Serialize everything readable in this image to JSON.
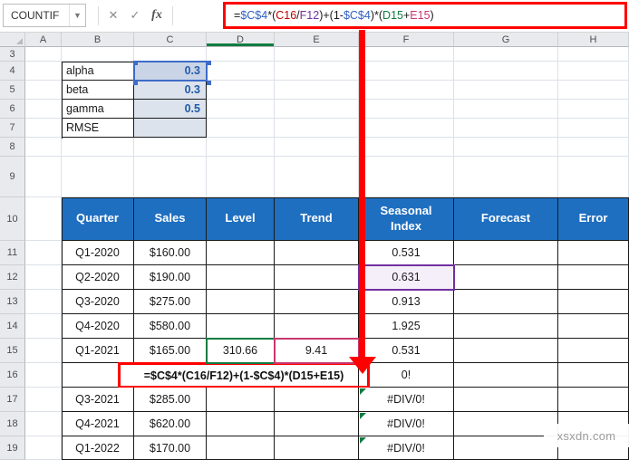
{
  "formula_bar": {
    "name_box": "COUNTIF",
    "fx_label": "fx",
    "formula_full": "=$C$4*(C16/F12)+(1-$C$4)*(D15+E15)",
    "formula_parts": [
      {
        "t": "=",
        "c": "#1a1a1a"
      },
      {
        "t": "$C$4",
        "c": "#2E5FC1"
      },
      {
        "t": "*(",
        "c": "#1a1a1a"
      },
      {
        "t": "C16",
        "c": "#C00000"
      },
      {
        "t": "/",
        "c": "#1a1a1a"
      },
      {
        "t": "F12",
        "c": "#7030A0"
      },
      {
        "t": ")+(1-",
        "c": "#1a1a1a"
      },
      {
        "t": "$C$4",
        "c": "#2E5FC1"
      },
      {
        "t": ")*(",
        "c": "#1a1a1a"
      },
      {
        "t": "D15",
        "c": "#107C41"
      },
      {
        "t": "+",
        "c": "#1a1a1a"
      },
      {
        "t": "E15",
        "c": "#C9366F"
      },
      {
        "t": ")",
        "c": "#1a1a1a"
      }
    ]
  },
  "icons": {
    "dropdown": "▼",
    "cancel": "✕",
    "enter": "✓"
  },
  "grid": {
    "column_letters": [
      "A",
      "B",
      "C",
      "D",
      "E",
      "F",
      "G",
      "H"
    ],
    "row_numbers": [
      "3",
      "4",
      "5",
      "6",
      "7",
      "8",
      "9",
      "10",
      "11",
      "12",
      "13",
      "14",
      "15",
      "16",
      "17",
      "18",
      "19"
    ],
    "selected_column": "D"
  },
  "params_table": {
    "selected_cell": "C4",
    "rows": [
      {
        "label": "alpha",
        "value": "0.3"
      },
      {
        "label": "beta",
        "value": "0.3"
      },
      {
        "label": "gamma",
        "value": "0.5"
      },
      {
        "label": "RMSE",
        "value": ""
      }
    ]
  },
  "main_table": {
    "headers": [
      "Quarter",
      "Sales",
      "Level",
      "Trend",
      "Seasonal Index",
      "Forecast",
      "Error"
    ],
    "rows": [
      {
        "quarter": "Q1-2020",
        "sales": "$160.00",
        "level": "",
        "trend": "",
        "seasonal": "0.531",
        "forecast": "",
        "error": ""
      },
      {
        "quarter": "Q2-2020",
        "sales": "$190.00",
        "level": "",
        "trend": "",
        "seasonal": "0.631",
        "forecast": "",
        "error": ""
      },
      {
        "quarter": "Q3-2020",
        "sales": "$275.00",
        "level": "",
        "trend": "",
        "seasonal": "0.913",
        "forecast": "",
        "error": ""
      },
      {
        "quarter": "Q4-2020",
        "sales": "$580.00",
        "level": "",
        "trend": "",
        "seasonal": "1.925",
        "forecast": "",
        "error": ""
      },
      {
        "quarter": "Q1-2021",
        "sales": "$165.00",
        "level": "310.66",
        "trend": "9.41",
        "seasonal": "0.531",
        "forecast": "",
        "error": ""
      },
      {
        "formula_row": true,
        "formula": "=$C$4*(C16/F12)+(1-$C$4)*(D15+E15)",
        "seasonal": "0!",
        "forecast": "",
        "error": ""
      },
      {
        "quarter": "Q3-2021",
        "sales": "$285.00",
        "level": "",
        "trend": "",
        "seasonal": "#DIV/0!",
        "forecast": "",
        "error": "",
        "error_indicator": true
      },
      {
        "quarter": "Q4-2021",
        "sales": "$620.00",
        "level": "",
        "trend": "",
        "seasonal": "#DIV/0!",
        "forecast": "",
        "error": "",
        "error_indicator": true
      },
      {
        "quarter": "Q1-2022",
        "sales": "$170.00",
        "level": "",
        "trend": "",
        "seasonal": "#DIV/0!",
        "forecast": "",
        "error": "",
        "error_indicator": true
      }
    ]
  },
  "colors": {
    "header_blue": "#1F6FC0",
    "param_value_blue": "#1F5BA8",
    "param_fill": "#DCE3EC",
    "annotation_red": "#FF0000",
    "selection_blue": "#3E6CC8",
    "ref_purple": "#7030A0",
    "ref_green": "#107C41",
    "ref_pink": "#C9366F",
    "error_indicator_green": "#107C41"
  },
  "watermark": "xsxdn.com"
}
